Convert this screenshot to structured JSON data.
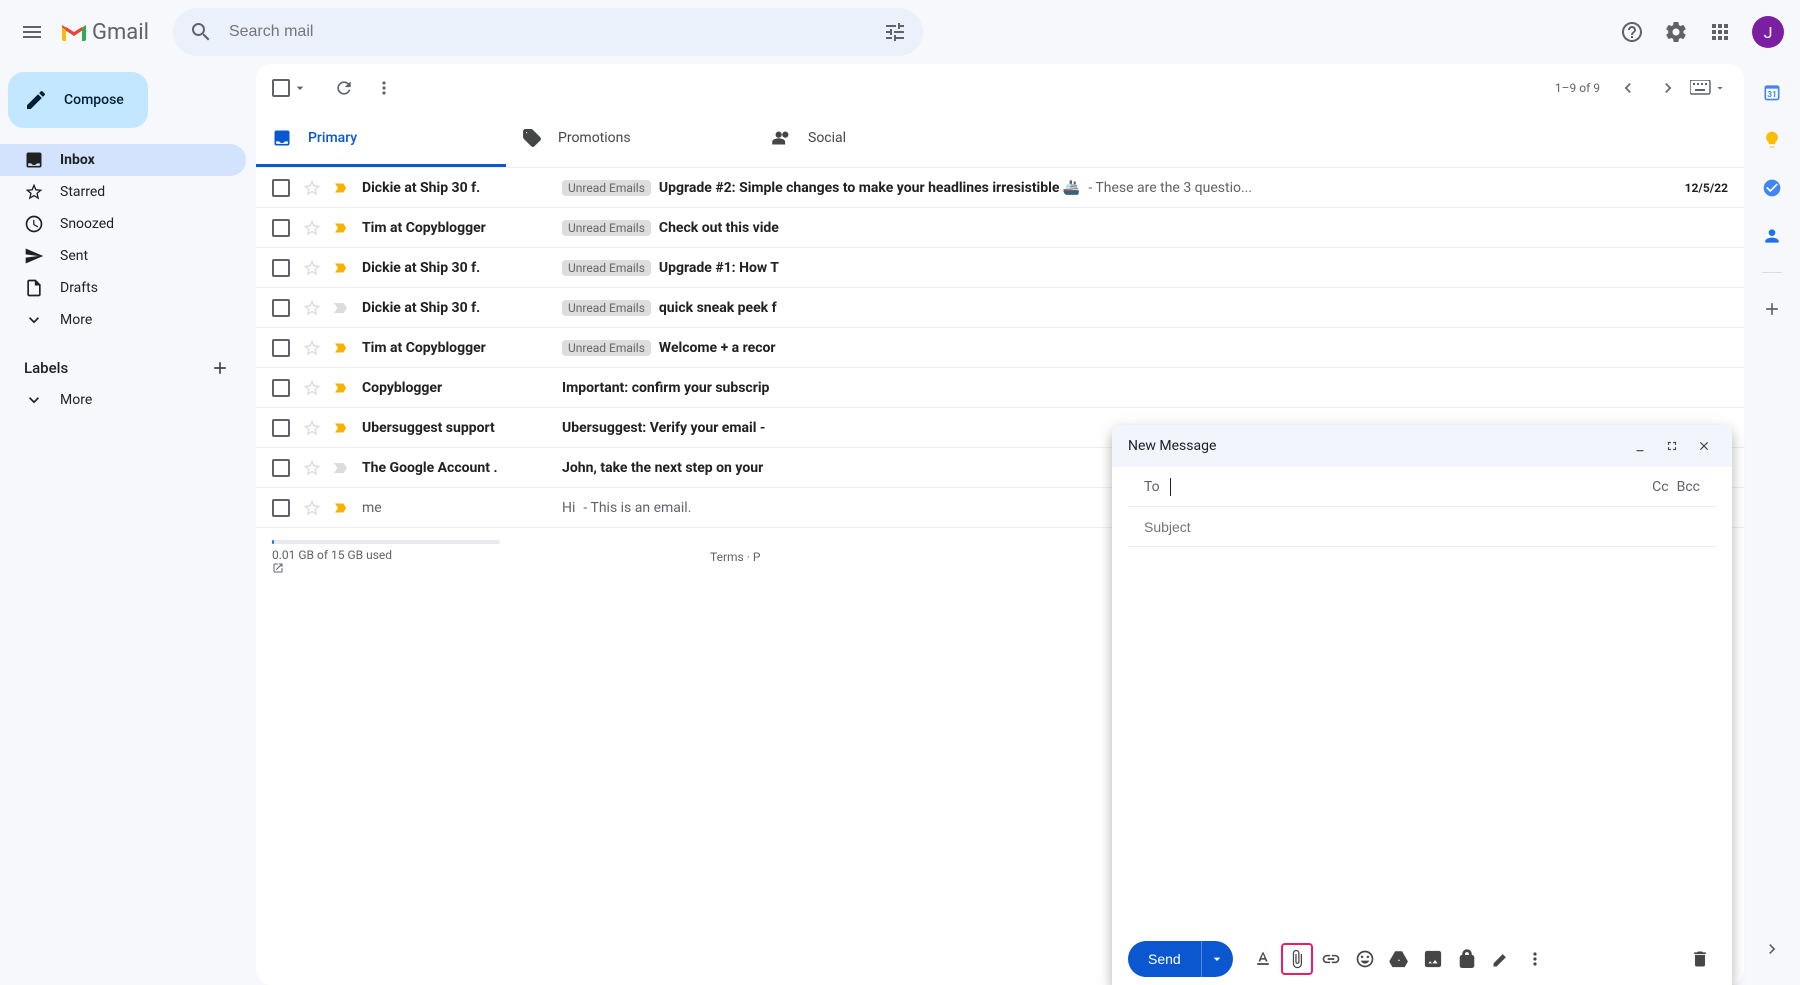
{
  "header": {
    "logo_text": "Gmail",
    "search_placeholder": "Search mail",
    "avatar_letter": "J"
  },
  "sidebar": {
    "compose_label": "Compose",
    "nav": [
      {
        "label": "Inbox",
        "active": true
      },
      {
        "label": "Starred"
      },
      {
        "label": "Snoozed"
      },
      {
        "label": "Sent"
      },
      {
        "label": "Drafts"
      },
      {
        "label": "More"
      }
    ],
    "labels_title": "Labels",
    "more_label": "More"
  },
  "toolbar": {
    "pagination": "1–9 of 9"
  },
  "tabs": [
    {
      "label": "Primary",
      "active": true
    },
    {
      "label": "Promotions"
    },
    {
      "label": "Social"
    }
  ],
  "emails": [
    {
      "sender": "Dickie at Ship 30 f.",
      "label": "Unread Emails",
      "subject": "Upgrade #2: Simple changes to make your headlines irresistible 🚢",
      "preview": " - These are the 3 questio...",
      "date": "12/5/22",
      "important": true,
      "read": false
    },
    {
      "sender": "Tim at Copyblogger",
      "label": "Unread Emails",
      "subject": "Check out this vide",
      "preview": "",
      "date": "",
      "important": true,
      "read": false
    },
    {
      "sender": "Dickie at Ship 30 f.",
      "label": "Unread Emails",
      "subject": "Upgrade #1: How T",
      "preview": "",
      "date": "",
      "important": true,
      "read": false
    },
    {
      "sender": "Dickie at Ship 30 f.",
      "label": "Unread Emails",
      "subject": "quick sneak peek f",
      "preview": "",
      "date": "",
      "important": false,
      "read": false
    },
    {
      "sender": "Tim at Copyblogger",
      "label": "Unread Emails",
      "subject": "Welcome + a recor",
      "preview": "",
      "date": "",
      "important": true,
      "read": false
    },
    {
      "sender": "Copyblogger",
      "label": "",
      "subject": "Important: confirm your subscrip",
      "preview": "",
      "date": "",
      "important": true,
      "read": false
    },
    {
      "sender": "Ubersuggest support",
      "label": "",
      "subject": "Ubersuggest: Verify your email - ",
      "preview": "",
      "date": "",
      "important": true,
      "read": false
    },
    {
      "sender": "The Google Account .",
      "label": "",
      "subject": "John, take the next step on your",
      "preview": "",
      "date": "",
      "important": false,
      "read": false
    },
    {
      "sender": "me",
      "label": "",
      "subject": "Hi",
      "preview": " - This is an email.",
      "date": "",
      "important": true,
      "read": true
    }
  ],
  "footer": {
    "storage": "0.01 GB of 15 GB used",
    "terms": "Terms",
    "dot": " · ",
    "privacy_prefix": "P"
  },
  "compose": {
    "title": "New Message",
    "to_label": "To",
    "cc_label": "Cc",
    "bcc_label": "Bcc",
    "subject_placeholder": "Subject",
    "send_label": "Send"
  }
}
